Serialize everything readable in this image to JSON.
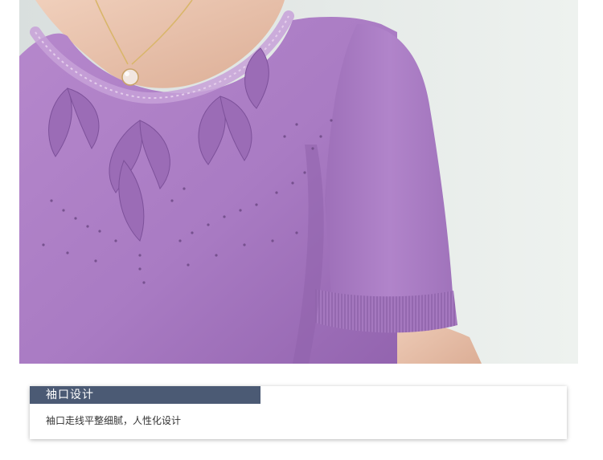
{
  "caption": {
    "title": "袖口设计",
    "description": "袖口走线平整细腻，人性化设计"
  },
  "colors": {
    "garment": "#a97bc3",
    "garment_dark": "#8f62ab",
    "garment_light": "#be98d1",
    "background": "#e2e8e5",
    "skin": "#e9c2ac",
    "title_bar": "#4b5a74"
  }
}
